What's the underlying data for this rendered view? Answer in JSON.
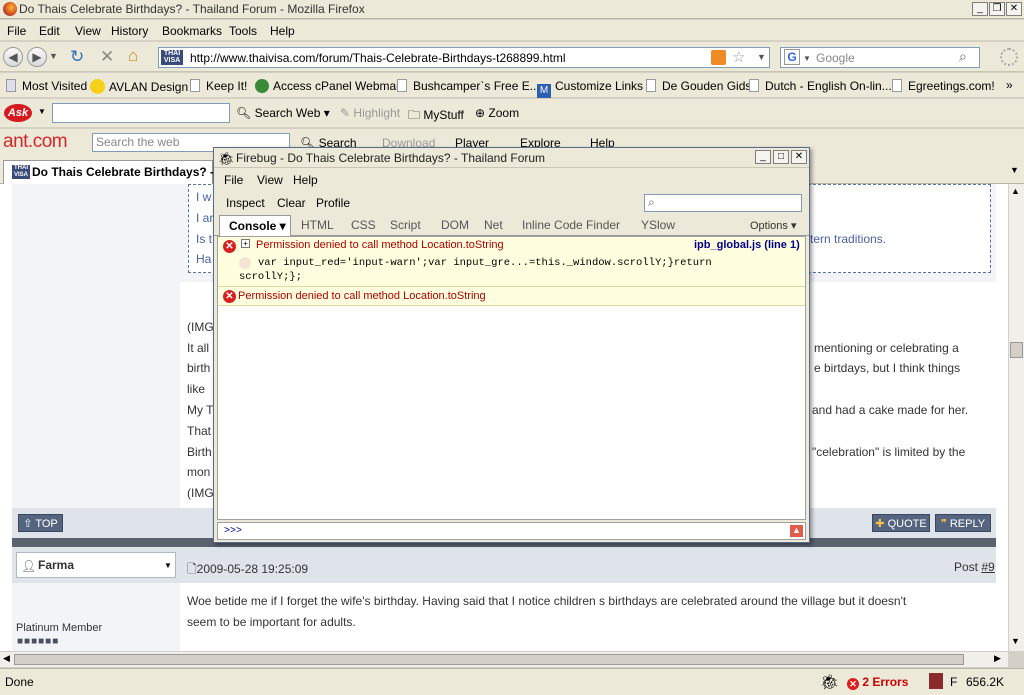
{
  "window": {
    "title": "Do Thais Celebrate Birthdays? - Thailand Forum - Mozilla Firefox"
  },
  "menu": [
    "File",
    "Edit",
    "View",
    "History",
    "Bookmarks",
    "Tools",
    "Help"
  ],
  "nav": {
    "url": "http://www.thaivisa.com/forum/Thais-Celebrate-Birthdays-t268899.html",
    "fav_label": "THAI VISA",
    "search_placeholder": "Google"
  },
  "bookmarks": [
    "Most Visited",
    "AVLAN Design",
    "Keep It!",
    "Access cPanel Webmail",
    "Bushcamper`s Free E...",
    "Customize Links",
    "De Gouden Gids",
    "Dutch - English On-lin...",
    "Egreetings.com!"
  ],
  "ask": {
    "search_label": "Search Web",
    "highlight": "Highlight",
    "mystuff": "MyStuff",
    "zoom": "Zoom"
  },
  "ant": {
    "logo": "ant.com",
    "search_placeholder": "Search the web",
    "search": "Search",
    "download": "Download",
    "player": "Player",
    "explore": "Explore",
    "help": "Help"
  },
  "tab": {
    "title": "Do Thais Celebrate Birthdays? -"
  },
  "page": {
    "left_lines": [
      "I w",
      "I ar",
      "Is t",
      "Ha"
    ],
    "right_fragment": "tern traditions.",
    "post1": {
      "lines": [
        {
          "l": "(IMG",
          "r": ""
        },
        {
          "l": "It all",
          "r": "mentioning or celebrating a"
        },
        {
          "l": "birth",
          "r": "e birtdays, but I think things"
        },
        {
          "l": "like",
          "r": ""
        },
        {
          "l": "My T",
          "r": "and had a cake made for her."
        },
        {
          "l": "That",
          "r": ""
        },
        {
          "l": "Birth",
          "r": "\"celebration\" is limited by the"
        },
        {
          "l": "mon",
          "r": ""
        },
        {
          "l": "(IMG",
          "r": ""
        }
      ],
      "top_button": "TOP",
      "quote_button": "QUOTE",
      "reply_button": "REPLY"
    },
    "post2": {
      "author": "Farma",
      "date": "2009-05-28 19:25:09",
      "post_label": "Post",
      "post_no": "#9",
      "rank": "Platinum Member",
      "text1": "Woe betide me if I forget the wife's birthday. Having said that I notice children s birthdays are celebrated around the village but it doesn't",
      "text2": "seem to be important for adults."
    }
  },
  "status": {
    "left": "Done",
    "errors": "2 Errors",
    "f": "F",
    "size": "656.2K"
  },
  "firebug": {
    "title": "Firebug - Do Thais Celebrate Birthdays? - Thailand Forum",
    "menu": [
      "File",
      "View",
      "Help"
    ],
    "toolbar": [
      "Inspect",
      "Clear",
      "Profile"
    ],
    "tabs": [
      "Console",
      "HTML",
      "CSS",
      "Script",
      "DOM",
      "Net",
      "Inline Code Finder",
      "YSlow"
    ],
    "options": "Options",
    "errors": [
      {
        "message": "Permission denied to call method Location.toString",
        "source": "ipb_global.js (line 1)",
        "code": "var input_red='input-warn';var input_gre...=this._window.scrollY;}return",
        "code2": "scrollY;};"
      },
      {
        "message": "Permission denied to call method Location.toString"
      }
    ],
    "prompt": ">>>"
  }
}
